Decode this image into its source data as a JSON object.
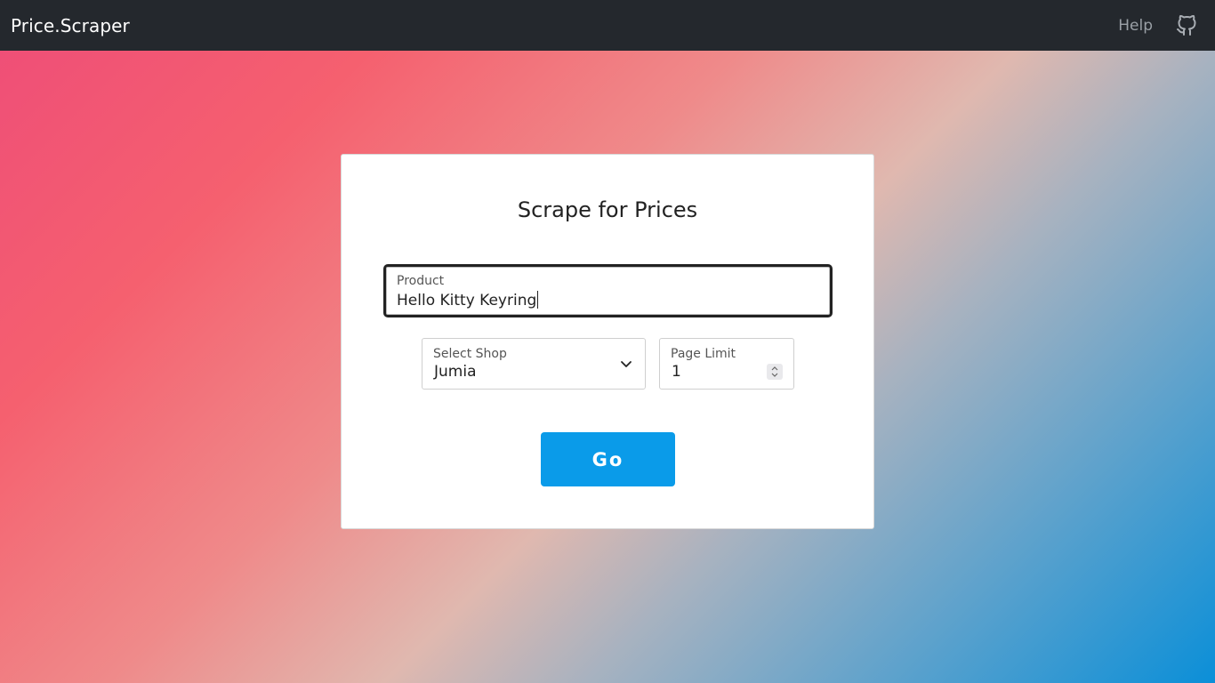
{
  "navbar": {
    "brand": "Price.Scraper",
    "help_label": "Help",
    "github_icon": "github-icon"
  },
  "form": {
    "title": "Scrape for Prices",
    "product": {
      "label": "Product",
      "value": "Hello Kitty Keyring"
    },
    "shop": {
      "label": "Select Shop",
      "value": "Jumia",
      "icon": "chevron-down-icon"
    },
    "page_limit": {
      "label": "Page Limit",
      "value": "1"
    },
    "submit_label": "Go"
  },
  "colors": {
    "navbar_bg": "#24282d",
    "button_bg": "#0a9be9",
    "gradient_start": "#ef4f77",
    "gradient_end": "#0b8fd8"
  }
}
